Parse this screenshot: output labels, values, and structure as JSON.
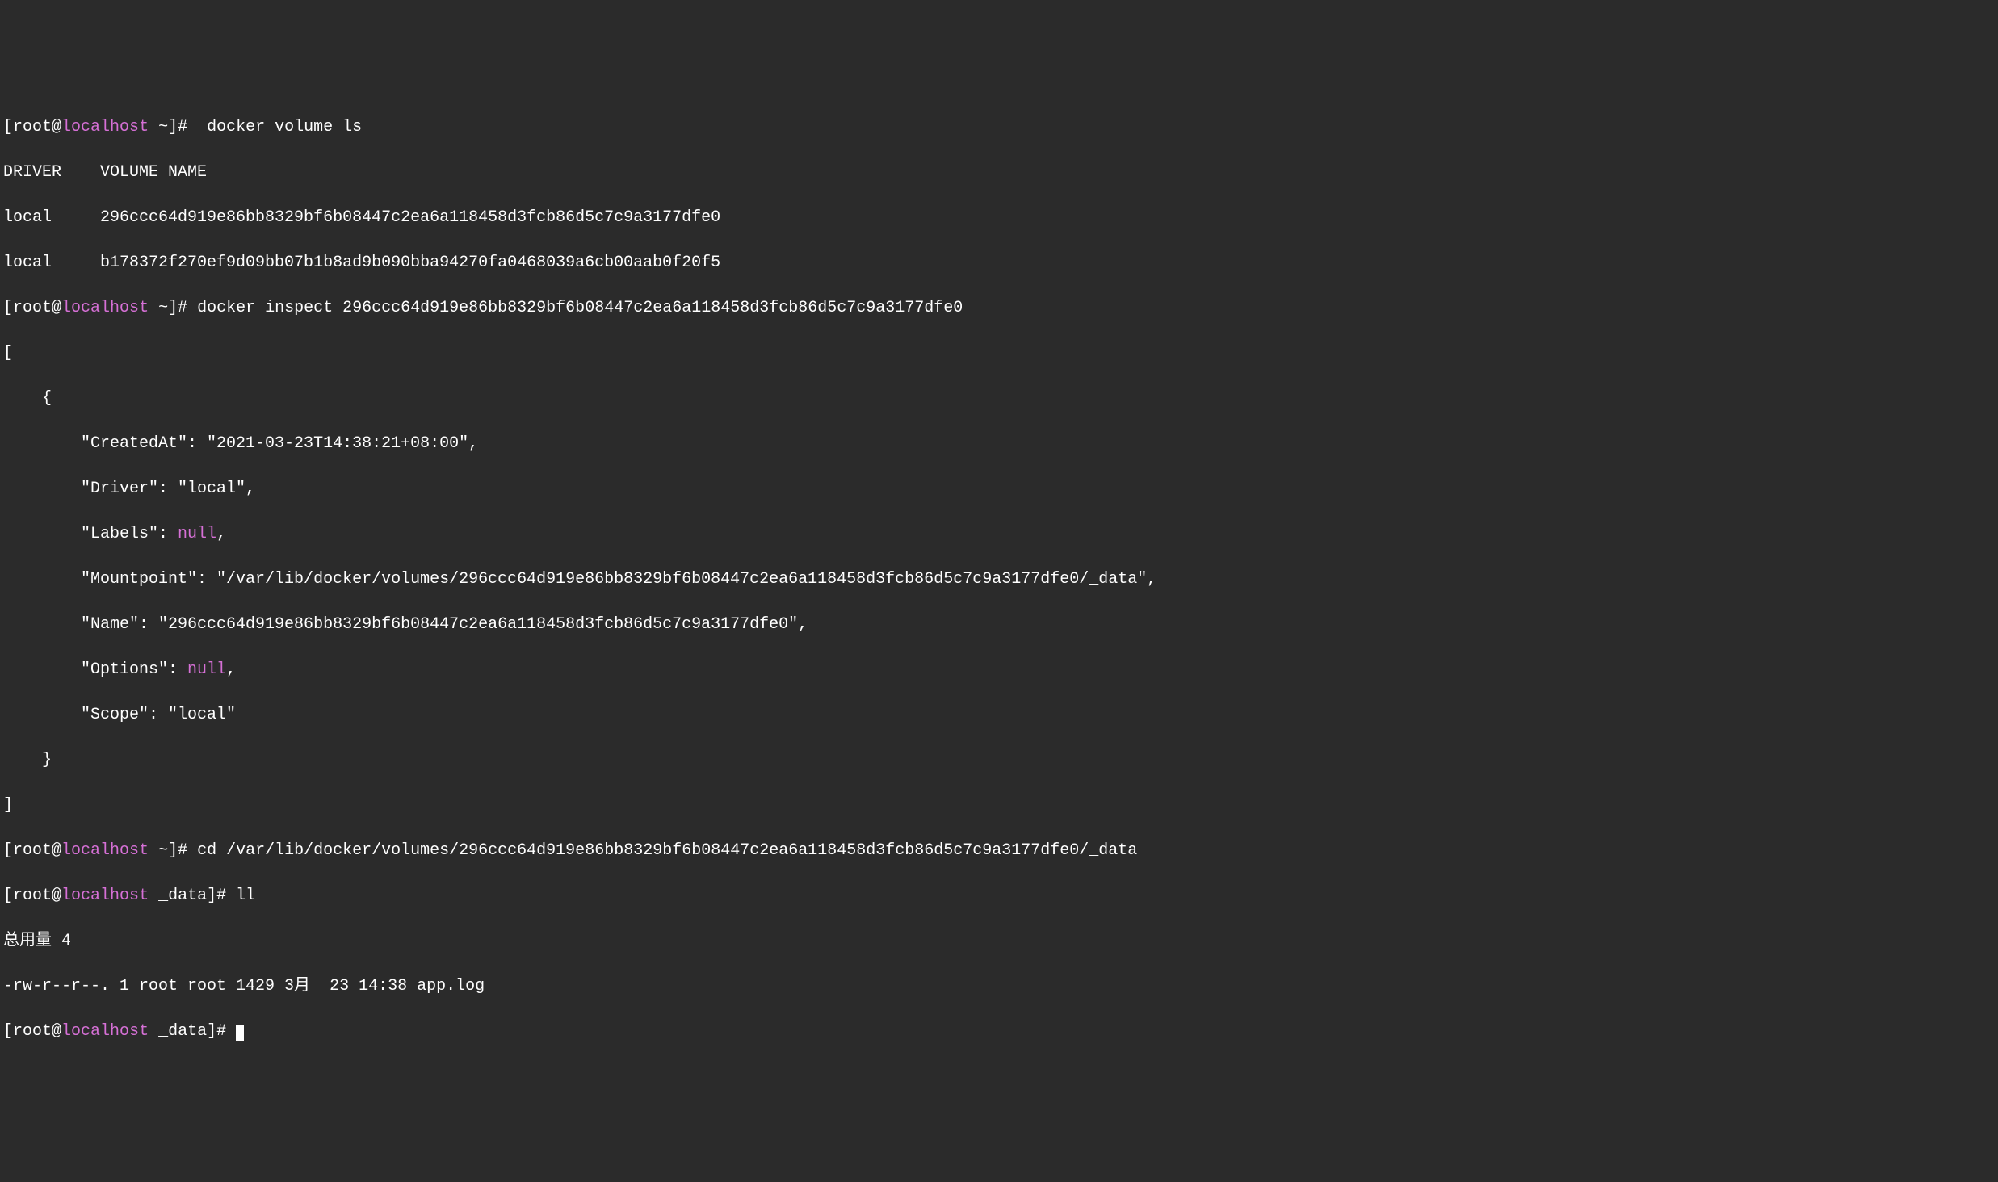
{
  "prompts": [
    {
      "user": "root",
      "at": "@",
      "host": "localhost",
      "path": " ~",
      "end": "]# ",
      "open": "[",
      "command": " docker volume ls"
    },
    {
      "user": "root",
      "at": "@",
      "host": "localhost",
      "path": " ~",
      "end": "]# ",
      "open": "[",
      "command": "docker inspect 296ccc64d919e86bb8329bf6b08447c2ea6a118458d3fcb86d5c7c9a3177dfe0"
    },
    {
      "user": "root",
      "at": "@",
      "host": "localhost",
      "path": " ~",
      "end": "]# ",
      "open": "[",
      "command": "cd /var/lib/docker/volumes/296ccc64d919e86bb8329bf6b08447c2ea6a118458d3fcb86d5c7c9a3177dfe0/_data"
    },
    {
      "user": "root",
      "at": "@",
      "host": "localhost",
      "path": " _data",
      "end": "]# ",
      "open": "[",
      "command": "ll"
    },
    {
      "user": "root",
      "at": "@",
      "host": "localhost",
      "path": " _data",
      "end": "]# ",
      "open": "[",
      "command": ""
    }
  ],
  "volumeLs": {
    "header": "DRIVER    VOLUME NAME",
    "rows": [
      "local     296ccc64d919e86bb8329bf6b08447c2ea6a118458d3fcb86d5c7c9a3177dfe0",
      "local     b178372f270ef9d09bb07b1b8ad9b090bba94270fa0468039a6cb00aab0f20f5"
    ]
  },
  "inspect": {
    "openBracket": "[",
    "openBrace": "    {",
    "createdAt": "        \"CreatedAt\": \"2021-03-23T14:38:21+08:00\",",
    "driver": "        \"Driver\": \"local\",",
    "labelsKey": "        \"Labels\": ",
    "labelsNull": "null",
    "labelsEnd": ",",
    "mountpoint": "        \"Mountpoint\": \"/var/lib/docker/volumes/296ccc64d919e86bb8329bf6b08447c2ea6a118458d3fcb86d5c7c9a3177dfe0/_data\",",
    "name": "        \"Name\": \"296ccc64d919e86bb8329bf6b08447c2ea6a118458d3fcb86d5c7c9a3177dfe0\",",
    "optionsKey": "        \"Options\": ",
    "optionsNull": "null",
    "optionsEnd": ",",
    "scope": "        \"Scope\": \"local\"",
    "closeBrace": "    }",
    "closeBracket": "]"
  },
  "ll": {
    "total": "总用量 4",
    "file": "-rw-r--r--. 1 root root 1429 3月  23 14:38 app.log"
  }
}
